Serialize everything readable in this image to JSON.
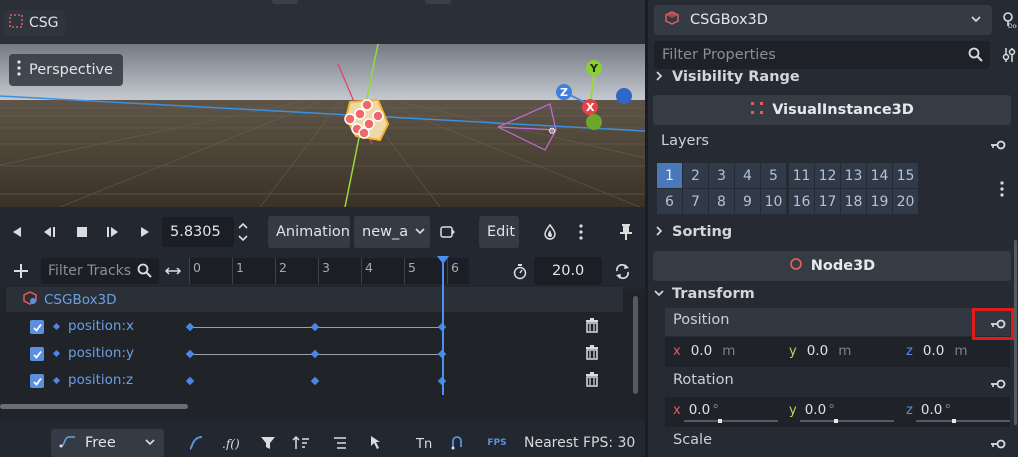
{
  "scene_tab": {
    "label": "CSG",
    "icon": "csg-node-icon"
  },
  "viewport": {
    "perspective_label": "Perspective",
    "gizmo_axes": [
      "Y",
      "Z",
      "X"
    ]
  },
  "animation": {
    "time_value": "5.8305",
    "animation_btn": "Animation",
    "anim_name": "new_a",
    "edit_btn": "Edit",
    "filter_tracks_placeholder": "Filter Tracks",
    "ruler_ticks": [
      "0",
      "1",
      "2",
      "3",
      "4",
      "5",
      "6"
    ],
    "length_value": "20.0",
    "group_name": "CSGBox3D",
    "tracks": [
      {
        "name": "position:x",
        "checked": true
      },
      {
        "name": "position:y",
        "checked": true
      },
      {
        "name": "position:z",
        "checked": true
      }
    ],
    "interp_mode": "Free",
    "fps_icon_label": "FPS",
    "fps_text": "Nearest FPS: 30"
  },
  "inspector": {
    "node_name": "CSGBox3D",
    "filter_placeholder": "Filter Properties",
    "visibility_range": "Visibility Range",
    "visual_instance": "VisualInstance3D",
    "layers_label": "Layers",
    "layers_row1": [
      "1",
      "2",
      "3",
      "4",
      "5",
      "11",
      "12",
      "13",
      "14",
      "15"
    ],
    "layers_row2": [
      "6",
      "7",
      "8",
      "9",
      "10",
      "16",
      "17",
      "18",
      "19",
      "20"
    ],
    "sorting": "Sorting",
    "node3d": "Node3D",
    "transform": "Transform",
    "position_label": "Position",
    "position": {
      "x": "0.0",
      "y": "0.0",
      "z": "0.0",
      "unit": "m"
    },
    "rotation_label": "Rotation",
    "rotation": {
      "x": "0.0",
      "y": "0.0",
      "z": "0.0",
      "unit": "°"
    },
    "scale_label": "Scale",
    "axis_colors": {
      "x": "#e35b5b",
      "y": "#c9d05a",
      "z": "#5b8fe0"
    }
  }
}
